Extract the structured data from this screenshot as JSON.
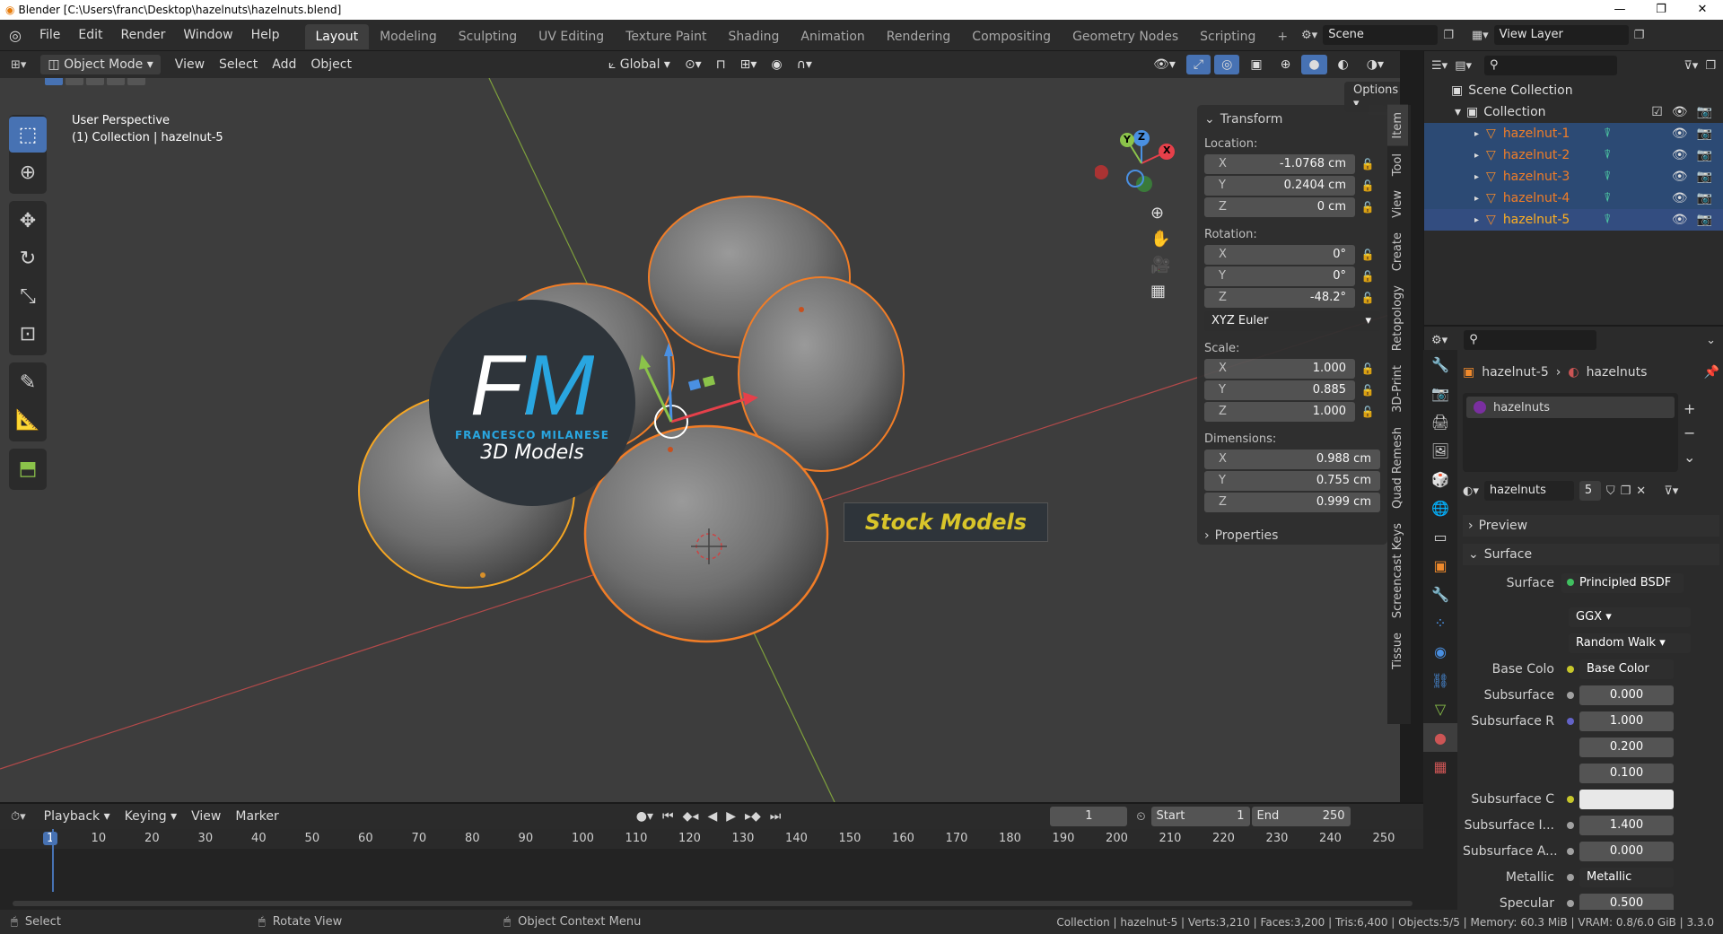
{
  "window": {
    "title": "Blender [C:\\Users\\franc\\Desktop\\hazelnuts\\hazelnuts.blend]",
    "min": "—",
    "max": "❐",
    "close": "✕"
  },
  "menu": [
    "File",
    "Edit",
    "Render",
    "Window",
    "Help"
  ],
  "workspaces": [
    "Layout",
    "Modeling",
    "Sculpting",
    "UV Editing",
    "Texture Paint",
    "Shading",
    "Animation",
    "Rendering",
    "Compositing",
    "Geometry Nodes",
    "Scripting"
  ],
  "workspace_add": "+",
  "scene": {
    "label": "Scene",
    "view_layer": "View Layer"
  },
  "viewport_header": {
    "mode": "Object Mode",
    "menus": [
      "View",
      "Select",
      "Add",
      "Object"
    ],
    "orientation": "Global",
    "options": "Options"
  },
  "viewport": {
    "perspective": "User Perspective",
    "collection_info": "(1) Collection | hazelnut-5",
    "gizmo_axes": {
      "x": "X",
      "y": "Y",
      "z": "Z"
    }
  },
  "watermark": {
    "logo": "FM",
    "name": "FRANCESCO MILANESE",
    "sub": "3D Models",
    "banner": "Stock Models"
  },
  "sidebar_tabs": [
    "Item",
    "Tool",
    "View",
    "Create",
    "Retopology",
    "3D-Print",
    "Quad Remesh",
    "Screencast Keys",
    "Tissue"
  ],
  "transform": {
    "title": "Transform",
    "location_label": "Location:",
    "location": [
      {
        "ax": "X",
        "v": "-1.0768 cm"
      },
      {
        "ax": "Y",
        "v": "0.2404 cm"
      },
      {
        "ax": "Z",
        "v": "0 cm"
      }
    ],
    "rotation_label": "Rotation:",
    "rotation": [
      {
        "ax": "X",
        "v": "0°"
      },
      {
        "ax": "Y",
        "v": "0°"
      },
      {
        "ax": "Z",
        "v": "-48.2°"
      }
    ],
    "rotation_mode": "XYZ Euler",
    "scale_label": "Scale:",
    "scale": [
      {
        "ax": "X",
        "v": "1.000"
      },
      {
        "ax": "Y",
        "v": "0.885"
      },
      {
        "ax": "Z",
        "v": "1.000"
      }
    ],
    "dimensions_label": "Dimensions:",
    "dimensions": [
      {
        "ax": "X",
        "v": "0.988 cm"
      },
      {
        "ax": "Y",
        "v": "0.755 cm"
      },
      {
        "ax": "Z",
        "v": "0.999 cm"
      }
    ],
    "properties": "Properties"
  },
  "outliner": {
    "scene_collection": "Scene Collection",
    "collection": "Collection",
    "objects": [
      "hazelnut-1",
      "hazelnut-2",
      "hazelnut-3",
      "hazelnut-4",
      "hazelnut-5"
    ]
  },
  "properties": {
    "breadcrumb_object": "hazelnut-5",
    "breadcrumb_material": "hazelnuts",
    "material_slot": "hazelnuts",
    "material_name": "hazelnuts",
    "material_users": "5",
    "preview": "Preview",
    "surface_panel": "Surface",
    "surface_label": "Surface",
    "surface_shader": "Principled BSDF",
    "distribution": "GGX",
    "subsurface_method": "Random Walk",
    "rows": [
      {
        "label": "Base Colo",
        "value": "Base Color",
        "dot": "#c7c72a",
        "linked": true
      },
      {
        "label": "Subsurface",
        "value": "0.000",
        "dot": "#a1a1a1"
      },
      {
        "label": "Subsurface R",
        "value": "1.000",
        "dot": "#6363c7"
      },
      {
        "label": "",
        "value": "0.200",
        "dot": ""
      },
      {
        "label": "",
        "value": "0.100",
        "dot": ""
      },
      {
        "label": "Subsurface C",
        "value": "",
        "dot": "#c7c72a",
        "swatch": true
      },
      {
        "label": "Subsurface I...",
        "value": "1.400",
        "dot": "#a1a1a1"
      },
      {
        "label": "Subsurface A...",
        "value": "0.000",
        "dot": "#a1a1a1"
      },
      {
        "label": "Metallic",
        "value": "Metallic",
        "dot": "#a1a1a1",
        "linked": true
      },
      {
        "label": "Specular",
        "value": "0.500",
        "dot": "#a1a1a1"
      }
    ]
  },
  "timeline": {
    "menus": [
      "Playback",
      "Keying",
      "View",
      "Marker"
    ],
    "current_frame": "1",
    "start_label": "Start",
    "start": "1",
    "end_label": "End",
    "end": "250",
    "ticks": [
      "1",
      "10",
      "20",
      "30",
      "40",
      "50",
      "60",
      "70",
      "80",
      "90",
      "100",
      "110",
      "120",
      "130",
      "140",
      "150",
      "160",
      "170",
      "180",
      "190",
      "200",
      "210",
      "220",
      "230",
      "240",
      "250"
    ]
  },
  "statusbar": {
    "select": "Select",
    "rotate": "Rotate View",
    "context": "Object Context Menu",
    "stats": "Collection | hazelnut-5 | Verts:3,210 | Faces:3,200 | Tris:6,400 | Objects:5/5 | Memory: 60.3 MiB | VRAM: 0.8/6.0 GiB | 3.3.0"
  },
  "colors": {
    "accent": "#4772b3",
    "selection_orange": "#f17d27",
    "active_yellow": "#ffb020",
    "x_axis": "#e6404a",
    "y_axis": "#8bc34a",
    "z_axis": "#4a90e2"
  }
}
